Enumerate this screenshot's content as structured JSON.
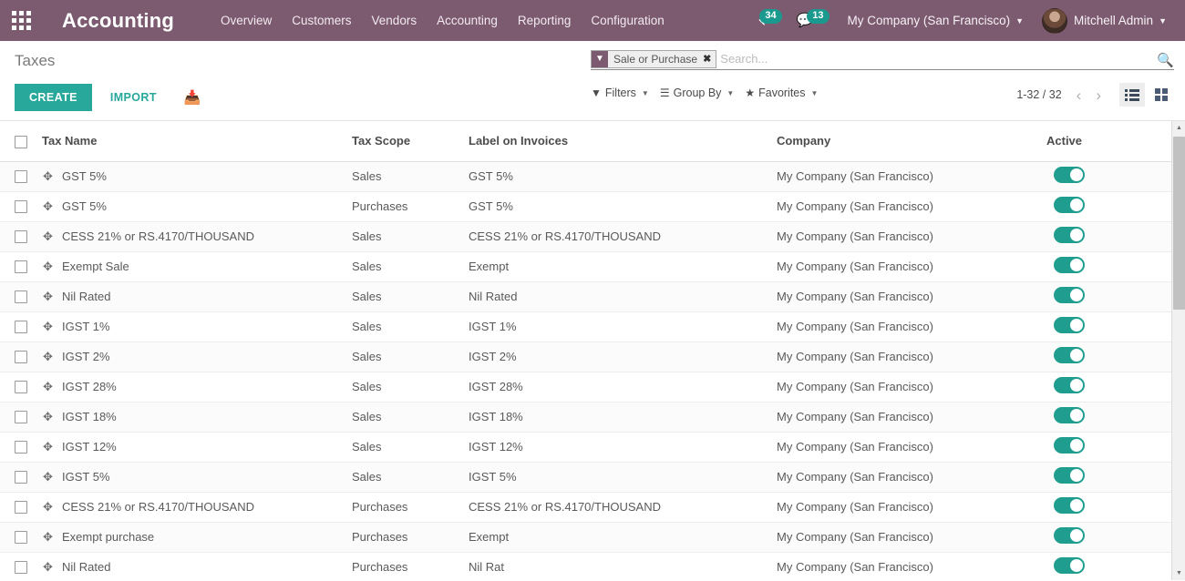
{
  "navbar": {
    "apps_icon": "apps-grid-icon",
    "brand": "Accounting",
    "menu": [
      {
        "label": "Overview"
      },
      {
        "label": "Customers"
      },
      {
        "label": "Vendors"
      },
      {
        "label": "Accounting"
      },
      {
        "label": "Reporting"
      },
      {
        "label": "Configuration"
      }
    ],
    "activity": {
      "icon": "clock-icon",
      "count": "34"
    },
    "messages": {
      "icon": "chat-icon",
      "count": "13"
    },
    "company": "My Company (San Francisco)",
    "user": "Mitchell Admin",
    "bg_color": "#7c5a70",
    "badge_color": "#1a998f"
  },
  "control_panel": {
    "title": "Taxes",
    "create_label": "CREATE",
    "import_label": "IMPORT",
    "upload_icon": "download-icon",
    "accent_color": "#28a79b"
  },
  "search": {
    "facet": {
      "icon": "filter-icon",
      "label": "Sale or Purchase",
      "remove": "✖"
    },
    "placeholder": "Search...",
    "value": "",
    "magnifier_icon": "search-icon"
  },
  "dropdowns": {
    "filters": "Filters",
    "group_by": "Group By",
    "favorites": "Favorites"
  },
  "pager": {
    "count": "1-32 / 32",
    "prev_icon": "chevron-left-icon",
    "next_icon": "chevron-right-icon"
  },
  "views": {
    "list": "list-view-icon",
    "kanban": "kanban-view-icon",
    "active": "list"
  },
  "table": {
    "columns": [
      {
        "key": "name",
        "label": "Tax Name"
      },
      {
        "key": "scope",
        "label": "Tax Scope"
      },
      {
        "key": "label",
        "label": "Label on Invoices"
      },
      {
        "key": "company",
        "label": "Company"
      },
      {
        "key": "active",
        "label": "Active"
      }
    ],
    "rows": [
      {
        "name": "GST 5%",
        "scope": "Sales",
        "label": "GST 5%",
        "company": "My Company (San Francisco)",
        "active": true
      },
      {
        "name": "GST 5%",
        "scope": "Purchases",
        "label": "GST 5%",
        "company": "My Company (San Francisco)",
        "active": true
      },
      {
        "name": "CESS 21% or RS.4170/THOUSAND",
        "scope": "Sales",
        "label": "CESS 21% or RS.4170/THOUSAND",
        "company": "My Company (San Francisco)",
        "active": true
      },
      {
        "name": "Exempt Sale",
        "scope": "Sales",
        "label": "Exempt",
        "company": "My Company (San Francisco)",
        "active": true
      },
      {
        "name": "Nil Rated",
        "scope": "Sales",
        "label": "Nil Rated",
        "company": "My Company (San Francisco)",
        "active": true
      },
      {
        "name": "IGST 1%",
        "scope": "Sales",
        "label": "IGST 1%",
        "company": "My Company (San Francisco)",
        "active": true
      },
      {
        "name": "IGST 2%",
        "scope": "Sales",
        "label": "IGST 2%",
        "company": "My Company (San Francisco)",
        "active": true
      },
      {
        "name": "IGST 28%",
        "scope": "Sales",
        "label": "IGST 28%",
        "company": "My Company (San Francisco)",
        "active": true
      },
      {
        "name": "IGST 18%",
        "scope": "Sales",
        "label": "IGST 18%",
        "company": "My Company (San Francisco)",
        "active": true
      },
      {
        "name": "IGST 12%",
        "scope": "Sales",
        "label": "IGST 12%",
        "company": "My Company (San Francisco)",
        "active": true
      },
      {
        "name": "IGST 5%",
        "scope": "Sales",
        "label": "IGST 5%",
        "company": "My Company (San Francisco)",
        "active": true
      },
      {
        "name": "CESS 21% or RS.4170/THOUSAND",
        "scope": "Purchases",
        "label": "CESS 21% or RS.4170/THOUSAND",
        "company": "My Company (San Francisco)",
        "active": true
      },
      {
        "name": "Exempt purchase",
        "scope": "Purchases",
        "label": "Exempt",
        "company": "My Company (San Francisco)",
        "active": true
      },
      {
        "name": "Nil Rated",
        "scope": "Purchases",
        "label": "Nil Rat",
        "company": "My Company (San Francisco)",
        "active": true
      }
    ],
    "drag_handle_icon": "drag-move-icon",
    "toggle_color": "#1f9e90"
  }
}
